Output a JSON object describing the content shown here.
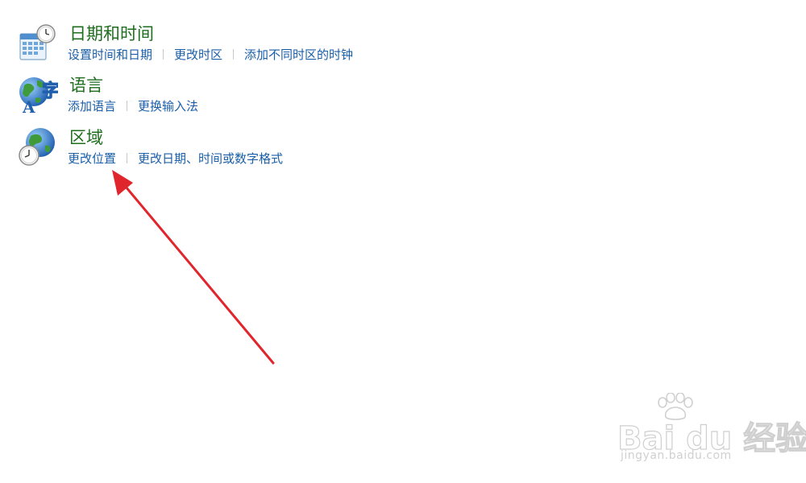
{
  "categories": [
    {
      "title": "日期和时间",
      "icon": "calendar-clock-icon",
      "links": [
        "设置时间和日期",
        "更改时区",
        "添加不同时区的时钟"
      ]
    },
    {
      "title": "语言",
      "icon": "language-globe-icon",
      "icon_glyphs": [
        "字",
        "A"
      ],
      "links": [
        "添加语言",
        "更换输入法"
      ]
    },
    {
      "title": "区域",
      "icon": "region-globe-clock-icon",
      "links": [
        "更改位置",
        "更改日期、时间或数字格式"
      ]
    }
  ],
  "annotation": {
    "type": "red-arrow",
    "target": "更改位置",
    "color": "#e0252d"
  },
  "watermark": {
    "brand": "Bai du 经验",
    "url": "jingyan.baidu.com"
  },
  "colors": {
    "title": "#1e6e1e",
    "link": "#1a5ea8",
    "separator": "#c8c8c8"
  }
}
